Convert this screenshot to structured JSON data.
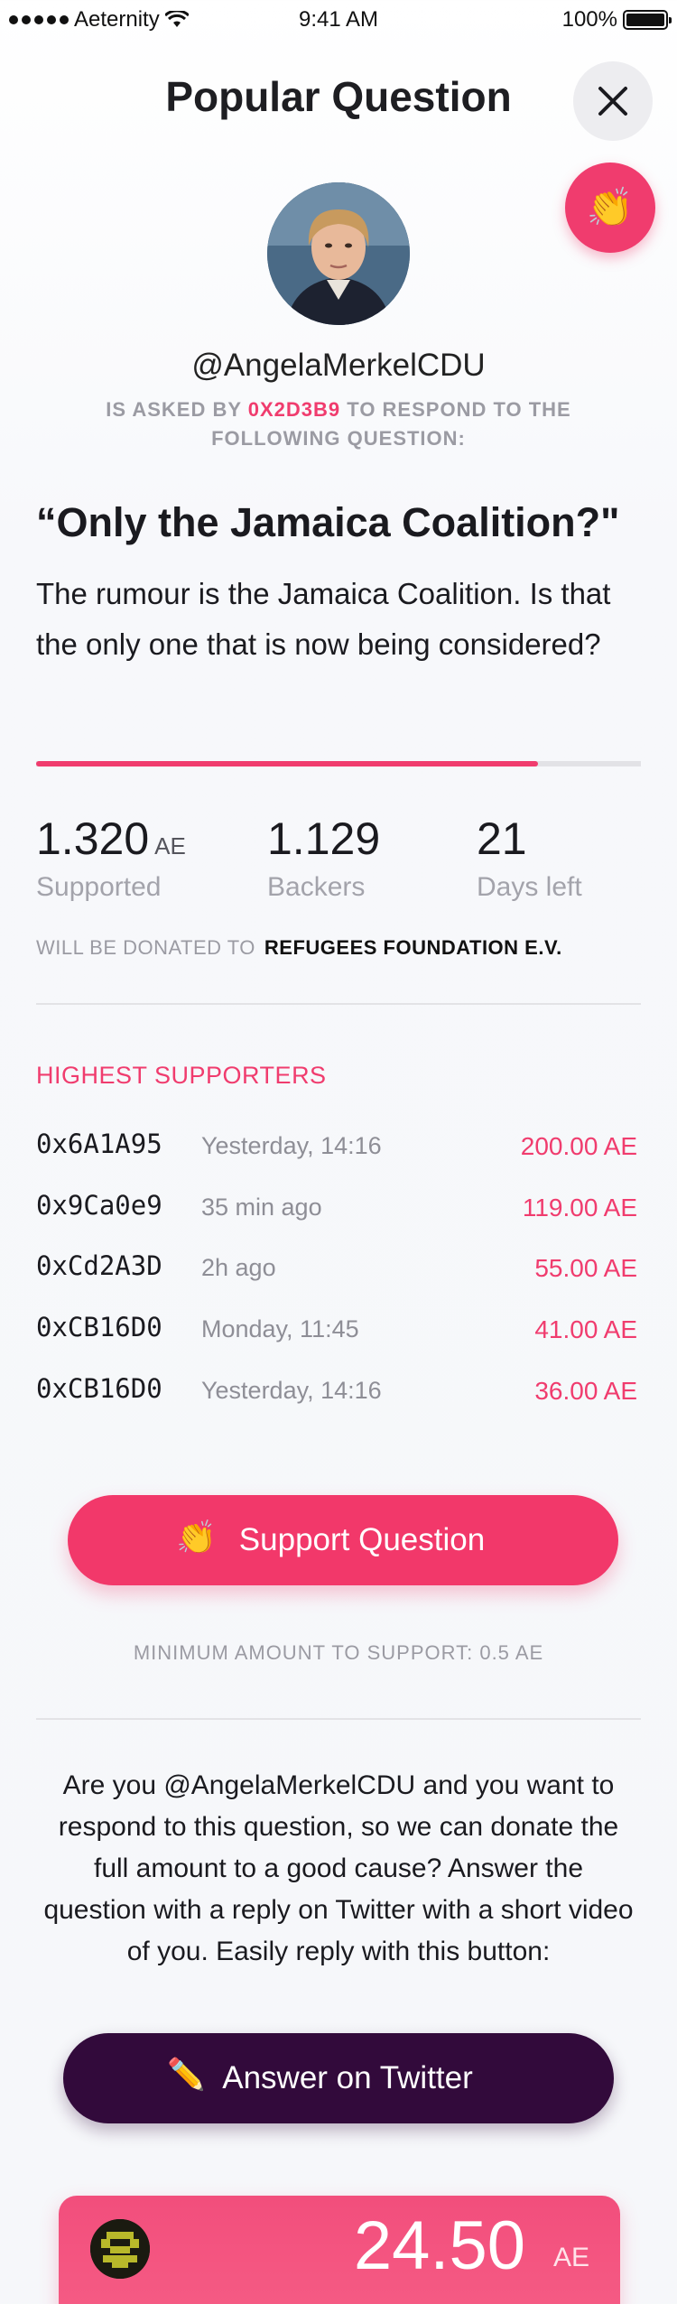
{
  "status_bar": {
    "carrier": "Aeternity",
    "time": "9:41 AM",
    "battery": "100%"
  },
  "header": {
    "title": "Popular Question"
  },
  "icons": {
    "close": "close-icon",
    "clap": "clapping-hands-icon",
    "pencil": "pencil-icon",
    "wifi": "wifi-icon",
    "battery": "battery-icon"
  },
  "profile": {
    "handle": "@AngelaMerkelCDU",
    "asked_prefix": "IS ASKED BY",
    "asker": "0X2D3B9",
    "asked_suffix": "TO RESPOND TO THE FOLLOWING QUESTION:"
  },
  "question": {
    "title": "“Only the Jamaica Coalition?\"",
    "body": "The rumour is the Jamaica Coalition. Is that the only one that is now being considered?",
    "progress": 0.83
  },
  "stats": {
    "supported_value": "1.320",
    "supported_unit": "AE",
    "supported_label": "Supported",
    "backers_value": "1.129",
    "backers_label": "Backers",
    "days_value": "21",
    "days_label": "Days left"
  },
  "donation": {
    "prefix": "WILL BE DONATED TO",
    "recipient": "REFUGEES FOUNDATION E.V."
  },
  "supporters": {
    "title": "HIGHEST SUPPORTERS",
    "rows": [
      {
        "address": "0x6A1A95",
        "time": "Yesterday, 14:16",
        "amount": "200.00 AE"
      },
      {
        "address": "0x9Ca0e9",
        "time": "35 min ago",
        "amount": "119.00 AE"
      },
      {
        "address": "0xCd2A3D",
        "time": "2h ago",
        "amount": "55.00 AE"
      },
      {
        "address": "0xCB16D0",
        "time": "Monday, 11:45",
        "amount": "41.00 AE"
      },
      {
        "address": "0xCB16D0",
        "time": "Yesterday, 14:16",
        "amount": "36.00 AE"
      }
    ]
  },
  "support_button": {
    "emoji": "👏",
    "label": "Support Question"
  },
  "minimum": {
    "text": "MINIMUM AMOUNT TO SUPPORT: 0.5 AE"
  },
  "respond": {
    "text": "Are you @AngelaMerkelCDU and you want to respond to this question, so we can donate the full amount to a good cause? Answer the question with a reply on Twitter with a short video of you. Easily reply with this button:"
  },
  "twitter_button": {
    "emoji": "✏️",
    "label": "Answer on Twitter"
  },
  "amount_card": {
    "value": "24.50",
    "unit": "AE"
  },
  "colors": {
    "accent": "#f03c6e",
    "dark_button": "#320a3b",
    "muted": "#9b9ba3"
  }
}
